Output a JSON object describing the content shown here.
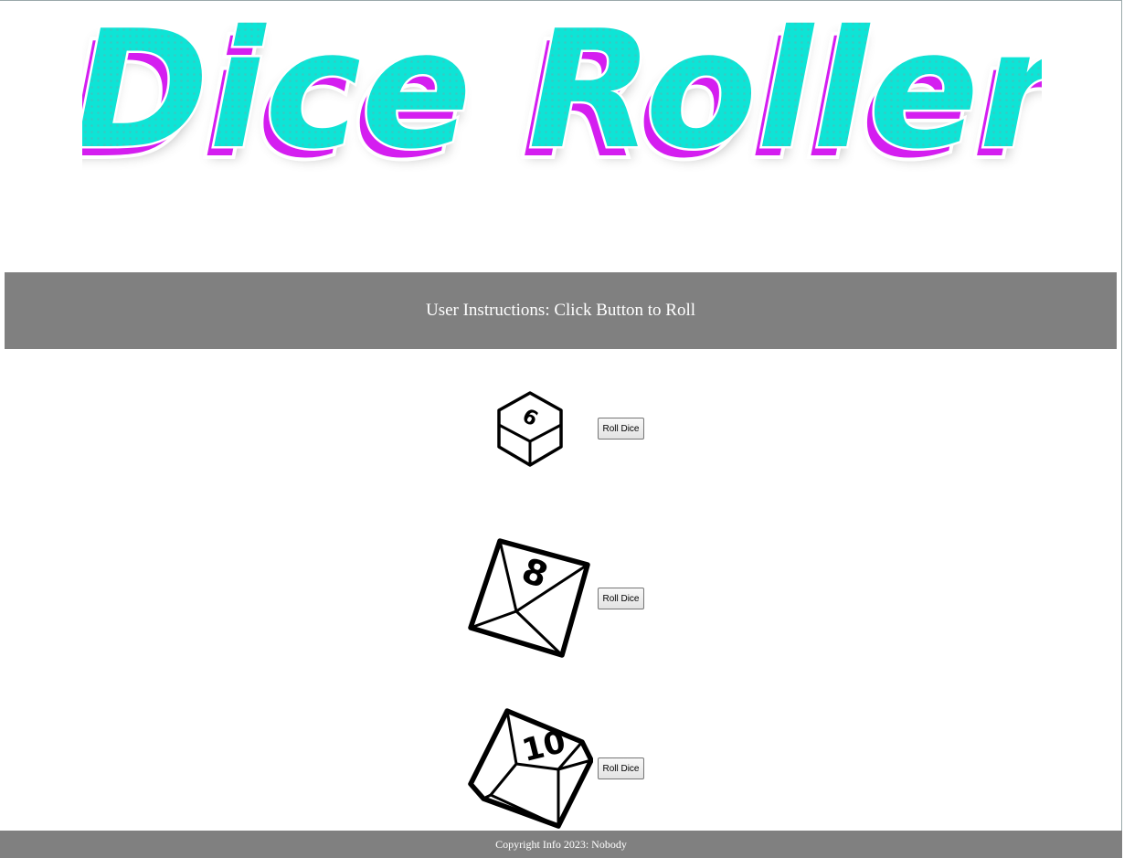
{
  "header": {
    "logo_text": "Dice Roller",
    "colors": {
      "fill": "#0ee4d6",
      "shadow": "#d41ef0",
      "outline": "#ffffff"
    }
  },
  "instructions": {
    "text": "User Instructions: Click Button to Roll"
  },
  "dice": [
    {
      "icon": "d6-die-icon",
      "face_label": "6",
      "button_label": "Roll Dice"
    },
    {
      "icon": "d8-die-icon",
      "face_label": "8",
      "button_label": "Roll Dice"
    },
    {
      "icon": "d10-die-icon",
      "face_label": "10",
      "button_label": "Roll Dice"
    }
  ],
  "footer": {
    "text": "Copyright Info 2023: Nobody",
    "background": "#808080"
  }
}
